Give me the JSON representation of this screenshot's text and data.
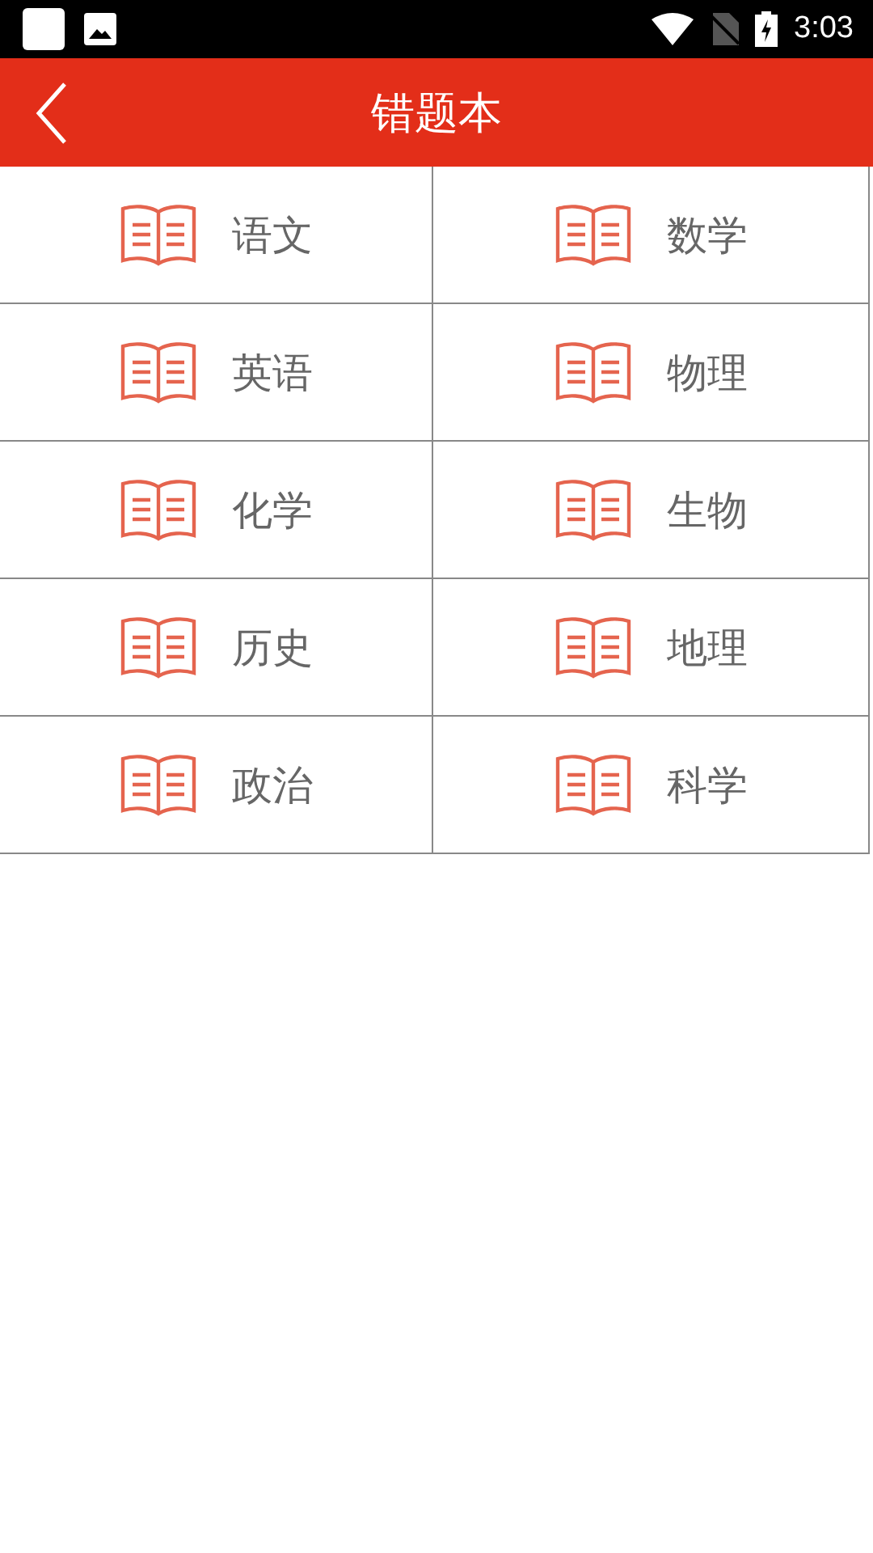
{
  "status_bar": {
    "time": "3:03"
  },
  "header": {
    "title": "错题本"
  },
  "subjects": [
    {
      "label": "语文"
    },
    {
      "label": "数学"
    },
    {
      "label": "英语"
    },
    {
      "label": "物理"
    },
    {
      "label": "化学"
    },
    {
      "label": "生物"
    },
    {
      "label": "历史"
    },
    {
      "label": "地理"
    },
    {
      "label": "政治"
    },
    {
      "label": "科学"
    }
  ]
}
